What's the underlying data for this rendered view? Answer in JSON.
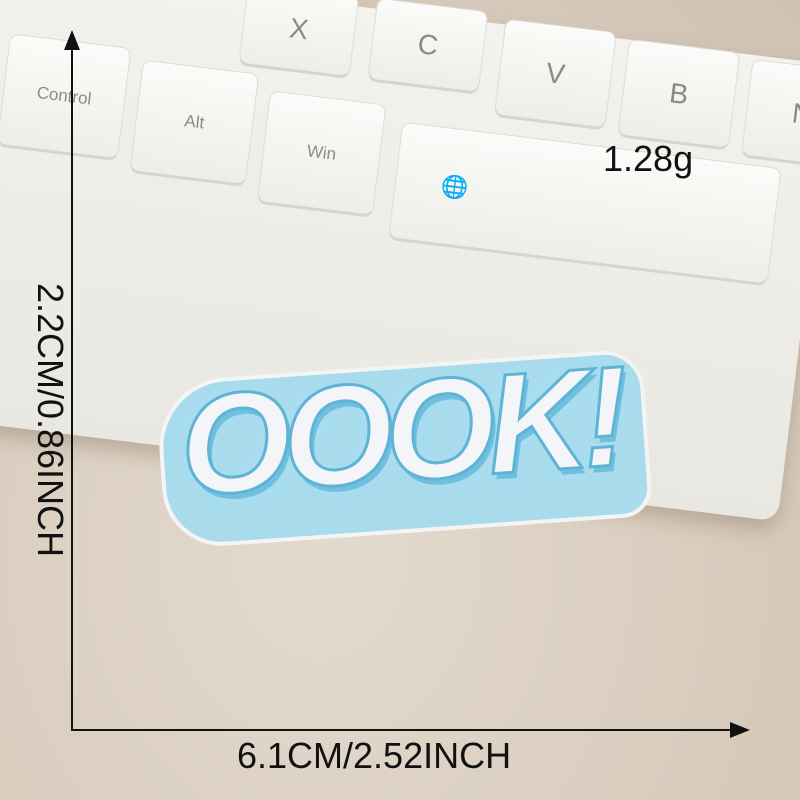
{
  "keyboard": {
    "keys": [
      "X",
      "C",
      "V",
      "B",
      "N",
      "Control",
      "Alt",
      "Win",
      "globe-icon"
    ]
  },
  "patch": {
    "text": "OOOK!"
  },
  "annotations": {
    "weight": "1.28g",
    "height": "2.2CM/0.86INCH",
    "width": "6.1CM/2.52INCH"
  },
  "colors": {
    "patch_blue": "#a8dbec",
    "keyboard": "#f0efeb",
    "fabric": "#d8ccbd"
  }
}
